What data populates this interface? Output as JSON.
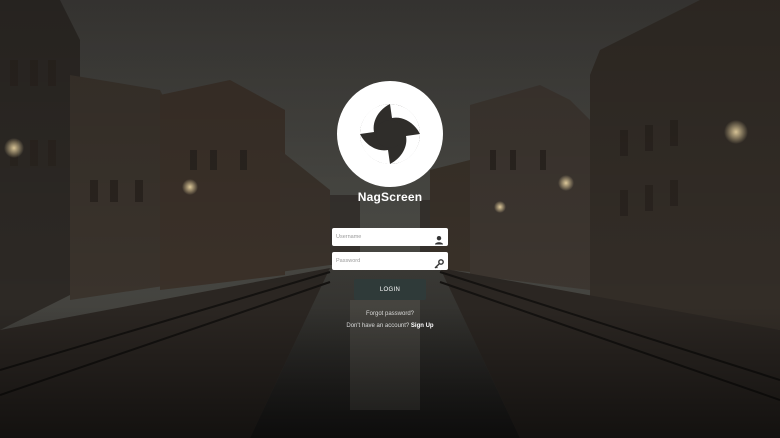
{
  "brand": {
    "name": "NagScreen",
    "logo_icon": "swirl-logo-icon"
  },
  "form": {
    "username": {
      "placeholder": "Username",
      "value": "",
      "icon": "user-icon"
    },
    "password": {
      "placeholder": "Password",
      "value": "",
      "icon": "key-icon"
    },
    "login_label": "LOGIN"
  },
  "links": {
    "forgot": "Forgot password?",
    "signup_prompt": "Don't have an account?",
    "signup_label": "Sign Up"
  },
  "colors": {
    "button_bg": "#2f3a39",
    "field_bg": "#ffffff",
    "text_light": "#d8d8d8"
  }
}
